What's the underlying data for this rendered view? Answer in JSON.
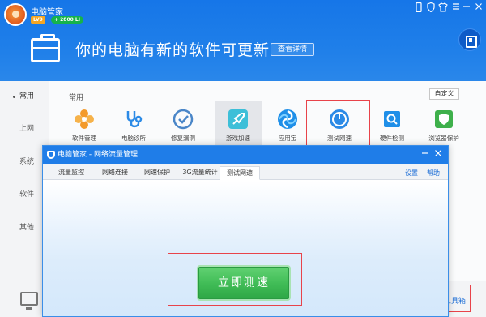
{
  "app": {
    "name": "电脑管家",
    "level_badge": "LV9",
    "vip_badge": "+ 2800 ⅬⅠ"
  },
  "banner": {
    "headline": "你的电脑有新的软件可更新",
    "details_button": "查看详情"
  },
  "sidebar": {
    "items": [
      {
        "label": "常用",
        "active": true
      },
      {
        "label": "上网",
        "active": false
      },
      {
        "label": "系统",
        "active": false
      },
      {
        "label": "软件",
        "active": false
      },
      {
        "label": "其他",
        "active": false
      }
    ]
  },
  "content": {
    "section_title": "常用",
    "customize_button": "自定义",
    "tools": [
      {
        "label": "软件管理",
        "icon": "flower-icon",
        "color": "#f39a2b"
      },
      {
        "label": "电脑诊所",
        "icon": "stethoscope-icon",
        "color": "#2b8ae6"
      },
      {
        "label": "修复漏洞",
        "icon": "shield-repair-icon",
        "color": "#4a86c8"
      },
      {
        "label": "游戏加速",
        "icon": "gamepad-rocket-icon",
        "color": "#3dbfd8"
      },
      {
        "label": "应用宝",
        "icon": "app-store-icon",
        "color": "#1f8fe8"
      },
      {
        "label": "测试网速",
        "icon": "speedometer-icon",
        "color": "#2b8ae6"
      },
      {
        "label": "硬件检测",
        "icon": "chip-search-icon",
        "color": "#1f8fe8"
      },
      {
        "label": "浏览器保护",
        "icon": "browser-shield-icon",
        "color": "#3eb04b"
      }
    ]
  },
  "dialog": {
    "title": "电脑管家 - 网络流量管理",
    "tabs": [
      {
        "label": "流量监控",
        "active": false
      },
      {
        "label": "网络连接",
        "active": false
      },
      {
        "label": "网速保护",
        "active": false
      },
      {
        "label": "3G流量统计",
        "active": false
      },
      {
        "label": "测试网速",
        "active": true
      }
    ],
    "settings_link": "设置",
    "help_link": "帮助",
    "speed_test_button": "立即测速"
  },
  "bottom": {
    "toolbox_link": "工具箱"
  }
}
